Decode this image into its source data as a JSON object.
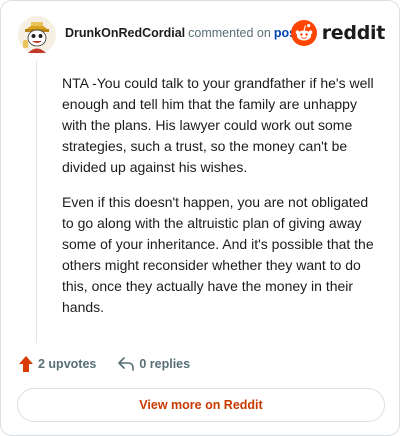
{
  "header": {
    "author": "DrunkOnRedCordial",
    "action_text": "commented on",
    "post_link": "post",
    "logo_text": "reddit"
  },
  "comment": {
    "paragraphs": [
      "NTA -You could talk to your grandfather if he's well enough and tell him that the family are unhappy with the plans. His lawyer could work out some strategies, such a trust, so the money can't be divided up against his wishes.",
      "Even if this doesn't happen, you are not obligated to go along with the altruistic plan of giving away some of your inheritance. And it's possible that the others might reconsider whether they want to do this, once they actually have the money in their hands."
    ]
  },
  "actions": {
    "upvotes_label": "2 upvotes",
    "replies_label": "0 replies"
  },
  "footer": {
    "view_more_label": "View more on Reddit"
  },
  "colors": {
    "upvote": "#d93a00",
    "reddit_orange": "#ff4500",
    "link_blue": "#0045ac",
    "button_text": "#c73a00"
  }
}
